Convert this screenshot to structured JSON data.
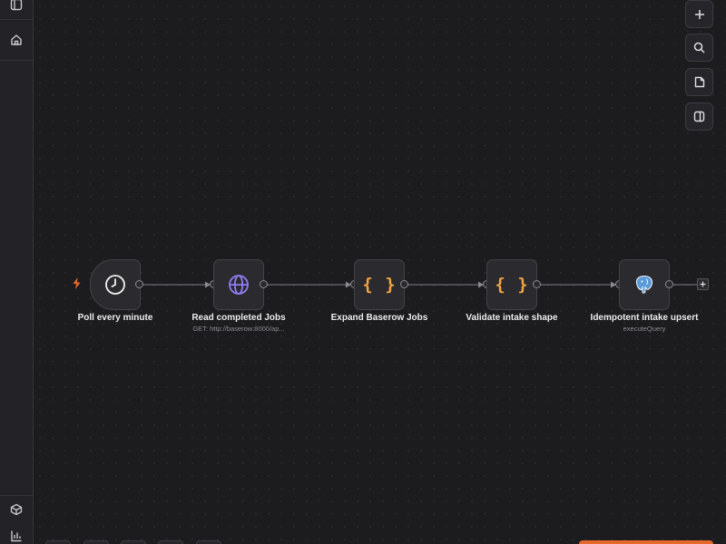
{
  "sidebar": {
    "items": [
      {
        "name": "sidebar-toggle",
        "icon": "panel-left-icon"
      },
      {
        "name": "overview",
        "icon": "home-icon"
      },
      {
        "name": "templates",
        "icon": "box-icon"
      },
      {
        "name": "insights",
        "icon": "bar-chart-icon"
      }
    ]
  },
  "toolbar": {
    "buttons": [
      {
        "name": "add-node",
        "icon": "plus-icon"
      },
      {
        "name": "search",
        "icon": "search-icon"
      },
      {
        "name": "sticky-note",
        "icon": "note-icon"
      },
      {
        "name": "toggle-panel",
        "icon": "panel-right-icon"
      }
    ]
  },
  "workflow": {
    "nodes": [
      {
        "label": "Poll every minute",
        "subtitle": "",
        "icon": "clock-icon"
      },
      {
        "label": "Read completed Jobs",
        "subtitle": "GET: http://baserow:8000/ap...",
        "icon": "globe-icon"
      },
      {
        "label": "Expand Baserow Jobs",
        "subtitle": "",
        "icon": "code-braces-icon"
      },
      {
        "label": "Validate intake shape",
        "subtitle": "",
        "icon": "code-braces-icon"
      },
      {
        "label": "Idempotent intake upsert",
        "subtitle": "executeQuery",
        "icon": "postgres-icon"
      }
    ],
    "brace_glyph": "{ }"
  },
  "colors": {
    "background": "#1c1b1e",
    "node": "#2b2a2e",
    "accent_orange": "#e4692a",
    "code_icon": "#f0a441",
    "http_icon": "#8f7df0",
    "postgres_icon": "#5b9ad8"
  }
}
